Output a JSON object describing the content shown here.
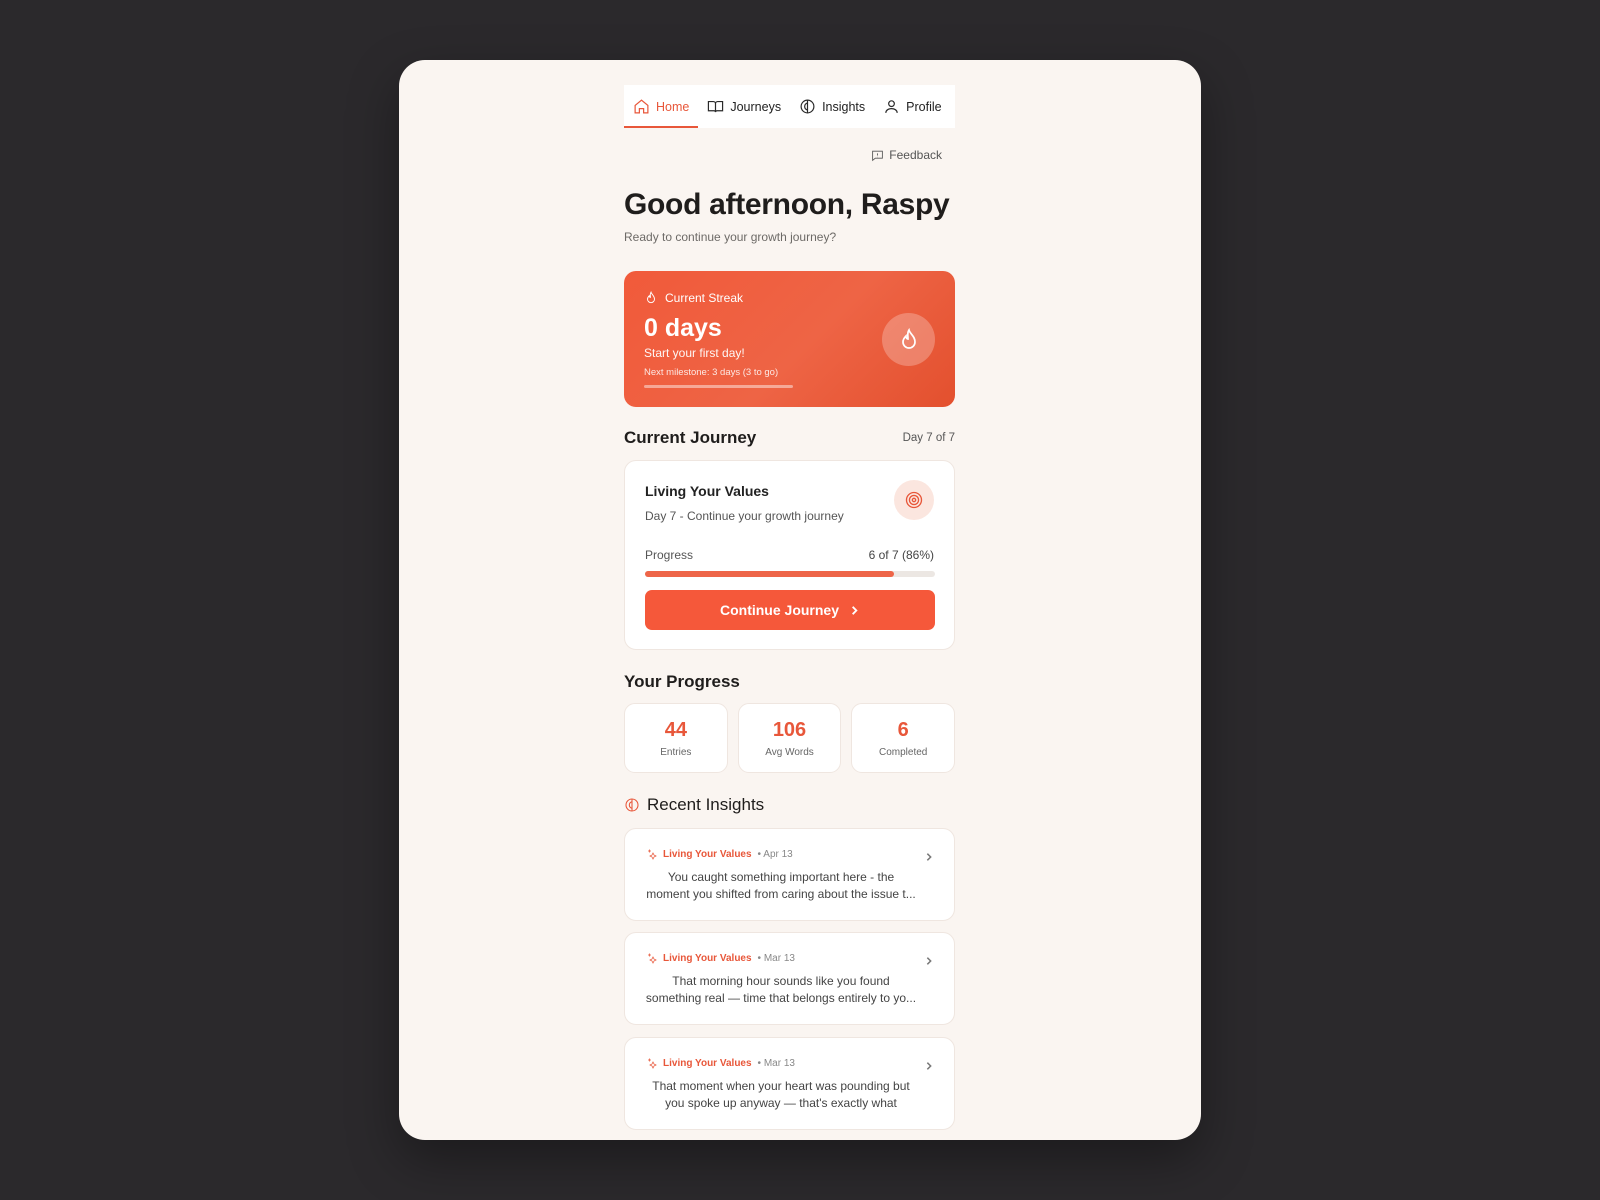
{
  "nav": {
    "items": [
      {
        "label": "Home",
        "icon": "home-icon",
        "active": true
      },
      {
        "label": "Journeys",
        "icon": "book-icon",
        "active": false
      },
      {
        "label": "Insights",
        "icon": "brain-icon",
        "active": false
      },
      {
        "label": "Profile",
        "icon": "user-icon",
        "active": false
      }
    ]
  },
  "feedback": {
    "label": "Feedback",
    "icon": "message-icon"
  },
  "greeting": {
    "title": "Good afternoon, Raspy",
    "subtitle": "Ready to continue your growth journey?"
  },
  "streak": {
    "label": "Current Streak",
    "days": "0 days",
    "subtitle": "Start your first day!",
    "milestone": "Next milestone: 3 days   (3 to go)",
    "progress": 0,
    "icon": "flame-icon"
  },
  "current_journey": {
    "section_title": "Current Journey",
    "day_label": "Day 7 of 7",
    "title": "Living Your Values",
    "subtitle": "Day 7 - Continue your growth journey",
    "progress_label": "Progress",
    "progress_value": "6 of 7 (86%)",
    "progress_fraction": 0.86,
    "button_label": "Continue Journey",
    "icon": "target-icon"
  },
  "your_progress": {
    "section_title": "Your Progress",
    "stats": [
      {
        "value": "44",
        "label": "Entries"
      },
      {
        "value": "106",
        "label": "Avg Words"
      },
      {
        "value": "6",
        "label": "Completed"
      }
    ]
  },
  "recent_insights": {
    "section_title": "Recent Insights",
    "items": [
      {
        "tag": "Living Your Values",
        "date": "• Apr 13",
        "text": "You caught something important here - the moment you shifted from caring about the issue t..."
      },
      {
        "tag": "Living Your Values",
        "date": "• Mar 13",
        "text": "That morning hour sounds like you found something real — time that belongs entirely to yo..."
      },
      {
        "tag": "Living Your Values",
        "date": "• Mar 13",
        "text": "That moment when your heart was pounding but you spoke up anyway — that's exactly what value..."
      }
    ]
  },
  "colors": {
    "accent": "#e8573a",
    "background": "#faf5f1",
    "page_bg": "#2b292c"
  }
}
